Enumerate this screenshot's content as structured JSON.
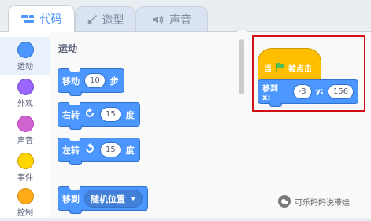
{
  "tabs": [
    {
      "label": "代码",
      "icon": "code-icon",
      "active": true
    },
    {
      "label": "造型",
      "icon": "brush-icon",
      "active": false
    },
    {
      "label": "声音",
      "icon": "speaker-icon",
      "active": false
    }
  ],
  "categories": [
    {
      "label": "运动",
      "color": "#4c97ff",
      "border": "#3373cc"
    },
    {
      "label": "外观",
      "color": "#9966ff",
      "border": "#774dcb"
    },
    {
      "label": "声音",
      "color": "#cf63cf",
      "border": "#bd42bd"
    },
    {
      "label": "事件",
      "color": "#ffd500",
      "border": "#cc9900"
    },
    {
      "label": "控制",
      "color": "#ffab19",
      "border": "#cf8b17"
    }
  ],
  "palette": {
    "title": "运动",
    "blocks": [
      {
        "text": "移动",
        "value": "10",
        "suffix": "步"
      },
      {
        "text": "右转",
        "value": "15",
        "suffix": "度",
        "icon": "rotate-right-icon"
      },
      {
        "text": "左转",
        "value": "15",
        "suffix": "度",
        "icon": "rotate-left-icon"
      },
      {
        "text": "移到",
        "dropdown": "随机位置"
      }
    ]
  },
  "workspace": {
    "hat": {
      "prefix": "当",
      "icon": "green-flag-icon",
      "suffix": "被点击"
    },
    "goto": {
      "label": "移到 x:",
      "x": "-3",
      "ylabel": "y:",
      "y": "156"
    }
  },
  "watermark": "可乐妈妈说带娃",
  "colors": {
    "motion": "#4c97ff",
    "events": "#ffbf00",
    "highlight": "#d20e17",
    "accent": "#4c97ff"
  }
}
